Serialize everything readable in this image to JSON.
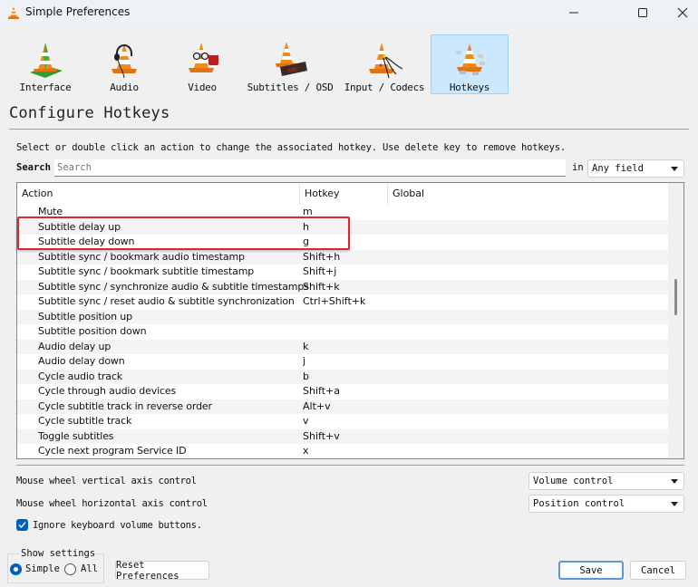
{
  "window": {
    "title": "Simple Preferences",
    "controls": {
      "minimize": "minimize-icon",
      "maximize": "maximize-icon",
      "close": "close-icon"
    }
  },
  "categories": [
    {
      "label": "Interface",
      "icon": "vlc-cone-interface-icon",
      "selected": false
    },
    {
      "label": "Audio",
      "icon": "vlc-cone-headphones-icon",
      "selected": false
    },
    {
      "label": "Video",
      "icon": "vlc-cone-glasses-icon",
      "selected": false
    },
    {
      "label": "Subtitles / OSD",
      "icon": "vlc-cone-subtitles-icon",
      "selected": false
    },
    {
      "label": "Input / Codecs",
      "icon": "vlc-cone-cables-icon",
      "selected": false
    },
    {
      "label": "Hotkeys",
      "icon": "vlc-cone-keys-icon",
      "selected": true
    }
  ],
  "section": {
    "title": "Configure Hotkeys",
    "hint": "Select or double click an action to change the associated hotkey. Use delete key to remove hotkeys."
  },
  "search": {
    "label": "Search",
    "placeholder": "Search",
    "value": "",
    "in_label": "in",
    "field_selected": "Any field"
  },
  "table": {
    "columns": [
      "Action",
      "Hotkey",
      "Global"
    ],
    "rows": [
      {
        "action": "Mute",
        "hotkey": "m",
        "global": ""
      },
      {
        "action": "Subtitle delay up",
        "hotkey": "h",
        "global": ""
      },
      {
        "action": "Subtitle delay down",
        "hotkey": "g",
        "global": ""
      },
      {
        "action": "Subtitle sync / bookmark audio timestamp",
        "hotkey": "Shift+h",
        "global": ""
      },
      {
        "action": "Subtitle sync / bookmark subtitle timestamp",
        "hotkey": "Shift+j",
        "global": ""
      },
      {
        "action": "Subtitle sync / synchronize audio & subtitle timestamps",
        "hotkey": "Shift+k",
        "global": ""
      },
      {
        "action": "Subtitle sync / reset audio & subtitle synchronization",
        "hotkey": "Ctrl+Shift+k",
        "global": ""
      },
      {
        "action": "Subtitle position up",
        "hotkey": "",
        "global": ""
      },
      {
        "action": "Subtitle position down",
        "hotkey": "",
        "global": ""
      },
      {
        "action": "Audio delay up",
        "hotkey": "k",
        "global": ""
      },
      {
        "action": "Audio delay down",
        "hotkey": "j",
        "global": ""
      },
      {
        "action": "Cycle audio track",
        "hotkey": "b",
        "global": ""
      },
      {
        "action": "Cycle through audio devices",
        "hotkey": "Shift+a",
        "global": ""
      },
      {
        "action": "Cycle subtitle track in reverse order",
        "hotkey": "Alt+v",
        "global": ""
      },
      {
        "action": "Cycle subtitle track",
        "hotkey": "v",
        "global": ""
      },
      {
        "action": "Toggle subtitles",
        "hotkey": "Shift+v",
        "global": ""
      },
      {
        "action": "Cycle next program Service ID",
        "hotkey": "x",
        "global": ""
      }
    ],
    "highlighted_rows": [
      "Subtitle delay up",
      "Subtitle delay down"
    ],
    "highlight_color": "#e0252b"
  },
  "mouse": {
    "vertical_label": "Mouse wheel vertical axis control",
    "vertical_value": "Volume control",
    "horizontal_label": "Mouse wheel horizontal axis control",
    "horizontal_value": "Position control"
  },
  "ignore_volume": {
    "label": "Ignore keyboard volume buttons.",
    "checked": true
  },
  "show_settings": {
    "legend": "Show settings",
    "options": [
      {
        "label": "Simple",
        "selected": true
      },
      {
        "label": "All",
        "selected": false
      }
    ]
  },
  "buttons": {
    "reset": "Reset Preferences",
    "save": "Save",
    "cancel": "Cancel"
  },
  "colors": {
    "accent": "#005fb8",
    "selected_category_bg": "#cce8ff",
    "highlight_box": "#e0252b"
  }
}
